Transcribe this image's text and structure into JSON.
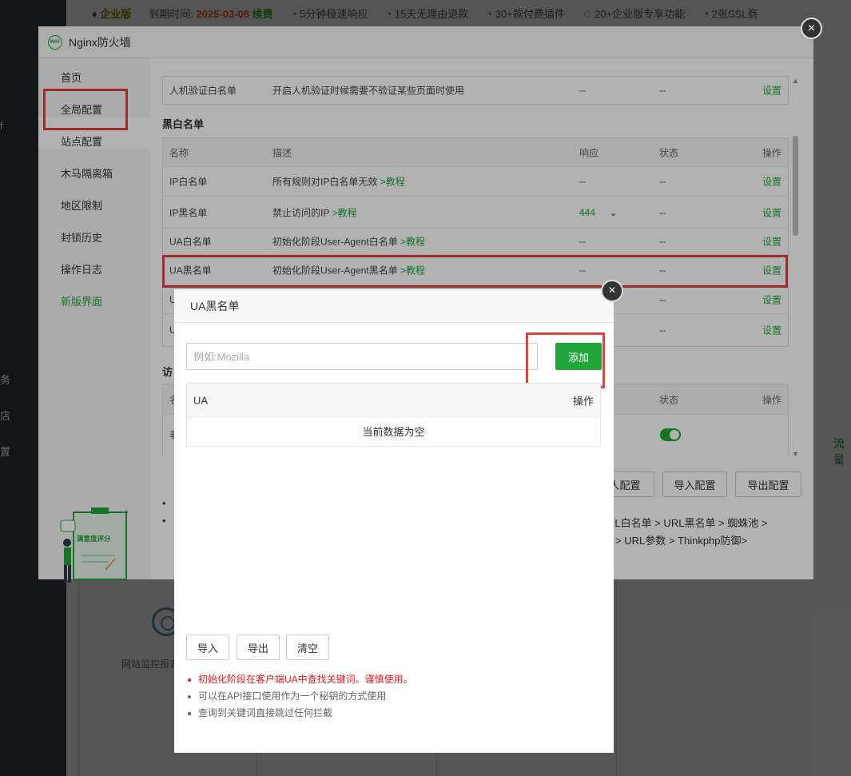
{
  "topbar": {
    "edition": "企业版",
    "expire_label": "到期时间:",
    "expire_date": "2025-03-08",
    "renew": "续费",
    "features": [
      "5分钟极速响应",
      "15天无理由退款",
      "30+款付费插件",
      "20+企业版专享功能",
      "2张SSL商"
    ]
  },
  "left_dark": {
    "fragments": [
      "f",
      "务",
      "店",
      "置"
    ]
  },
  "bg": {
    "monitor_label": "网站监控报表",
    "right_tab": "流量"
  },
  "modal": {
    "logo_text": "WAF",
    "title": "Nginx防火墙",
    "close": "×"
  },
  "sidebar": {
    "items": [
      {
        "label": "首页"
      },
      {
        "label": "全局配置"
      },
      {
        "label": "站点配置"
      },
      {
        "label": "木马隔离箱"
      },
      {
        "label": "地区限制"
      },
      {
        "label": "封锁历史"
      },
      {
        "label": "操作日志"
      },
      {
        "label": "新版界面"
      }
    ],
    "illustration_text": "满意度评分"
  },
  "top_row": {
    "name": "人机验证白名单",
    "desc": "开启人机验证时候需要不验证某些页面时使用",
    "resp": "--",
    "status": "--",
    "op": "设置"
  },
  "blackwhite": {
    "title": "黑白名单",
    "headers": [
      "名称",
      "描述",
      "响应",
      "状态",
      "操作"
    ],
    "rows": [
      {
        "name": "IP白名单",
        "desc": "所有规则对IP白名单无效",
        "tut": ">教程",
        "resp": "--",
        "status": "--",
        "op": "设置"
      },
      {
        "name": "IP黑名单",
        "desc": "禁止访问的IP",
        "tut": ">教程",
        "resp": "444",
        "status": "--",
        "op": "设置"
      },
      {
        "name": "UA白名单",
        "desc": "初始化阶段User-Agent白名单",
        "tut": ">教程",
        "resp": "--",
        "status": "--",
        "op": "设置"
      },
      {
        "name": "UA黑名单",
        "desc": "初始化阶段User-Agent黑名单",
        "tut": ">教程",
        "resp": "--",
        "status": "--",
        "op": "设置"
      },
      {
        "name": "U",
        "desc": "",
        "tut": "",
        "resp": "",
        "status": "--",
        "op": "设置"
      },
      {
        "name": "U",
        "desc": "",
        "tut": "",
        "resp": "",
        "status": "--",
        "op": "设置"
      }
    ]
  },
  "access_section": {
    "title_fragment": "访",
    "header_fragment": "名",
    "row_fragment": "非",
    "headers_right": [
      "状态",
      "操作"
    ]
  },
  "footer_buttons": {
    "config_fragment": "人配置",
    "import": "导入配置",
    "export": "导出配置"
  },
  "bottom_text": {
    "line1": "RL白名单 > URL黑名单 > 蜘蛛池 >",
    "line2": "> URL参数 > Thinkphp防御>"
  },
  "ua_dialog": {
    "title": "UA黑名单",
    "close": "×",
    "input_placeholder": "例如:Mozilla",
    "add_button": "添加",
    "table_headers": {
      "ua": "UA",
      "op": "操作"
    },
    "empty_text": "当前数据为空",
    "buttons": {
      "import": "导入",
      "export": "导出",
      "clear": "清空"
    },
    "notes": [
      "初始化阶段在客户端UA中查找关键词。谨慎使用。",
      "可以在API接口使用作为一个秘钥的方式使用",
      "查询到关键词直接跳过任何拦截"
    ]
  },
  "colors": {
    "accent": "#20a53a",
    "highlight": "#e34040",
    "warn": "#e21b1b"
  }
}
